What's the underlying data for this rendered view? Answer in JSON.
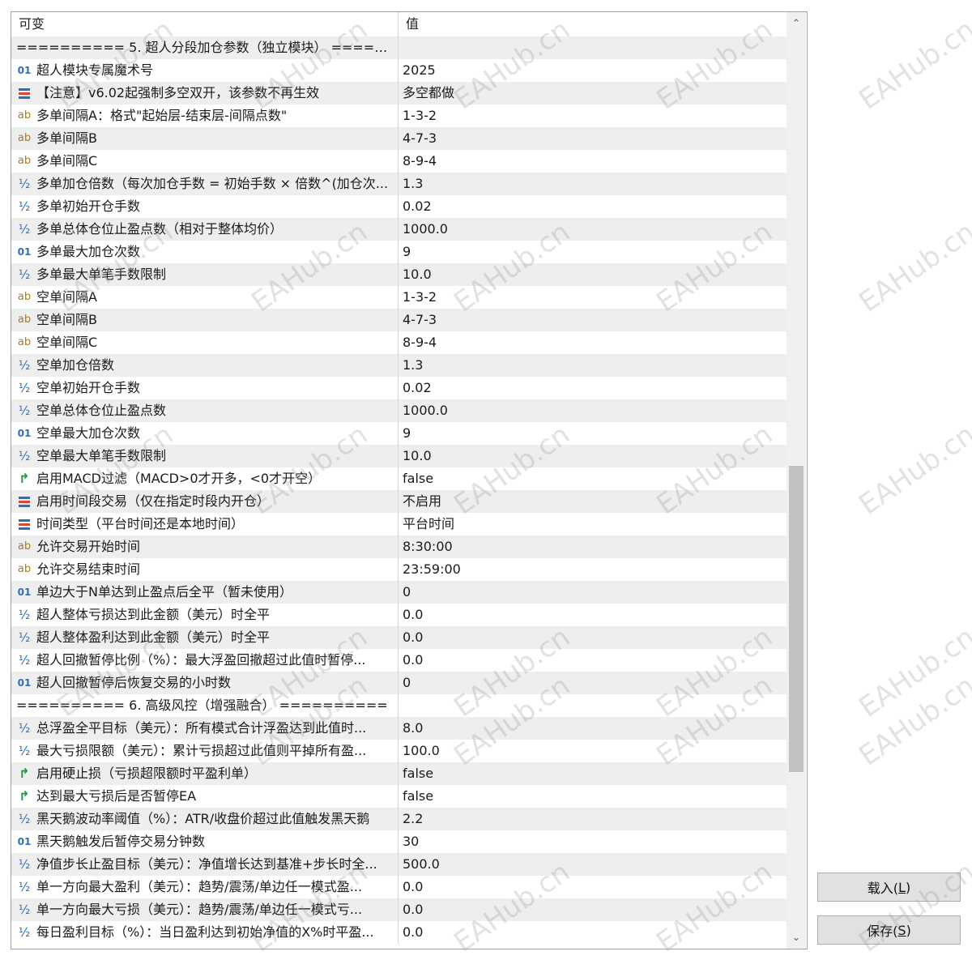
{
  "table": {
    "col_variable": "可变",
    "col_value": "值"
  },
  "rows": [
    {
      "type": "sep",
      "label": "========== 5. 超人分段加仓参数（独立模块） =======...",
      "value": ""
    },
    {
      "type": "int",
      "label": "超人模块专属魔术号",
      "value": "2025"
    },
    {
      "type": "enum",
      "label": "【注意】v6.02起强制多空双开，该参数不再生效",
      "value": "多空都做"
    },
    {
      "type": "str",
      "label": "多单间隔A：格式\"起始层-结束层-间隔点数\"",
      "value": "1-3-2"
    },
    {
      "type": "str",
      "label": "多单间隔B",
      "value": "4-7-3"
    },
    {
      "type": "str",
      "label": "多单间隔C",
      "value": "8-9-4"
    },
    {
      "type": "dbl",
      "label": "多单加仓倍数（每次加仓手数 = 初始手数 × 倍数^(加仓次...",
      "value": "1.3"
    },
    {
      "type": "dbl",
      "label": "多单初始开仓手数",
      "value": "0.02"
    },
    {
      "type": "dbl",
      "label": "多单总体仓位止盈点数（相对于整体均价）",
      "value": "1000.0"
    },
    {
      "type": "int",
      "label": "多单最大加仓次数",
      "value": "9"
    },
    {
      "type": "dbl",
      "label": "多单最大单笔手数限制",
      "value": "10.0"
    },
    {
      "type": "str",
      "label": "空单间隔A",
      "value": "1-3-2"
    },
    {
      "type": "str",
      "label": "空单间隔B",
      "value": "4-7-3"
    },
    {
      "type": "str",
      "label": "空单间隔C",
      "value": "8-9-4"
    },
    {
      "type": "dbl",
      "label": "空单加仓倍数",
      "value": "1.3"
    },
    {
      "type": "dbl",
      "label": "空单初始开仓手数",
      "value": "0.02"
    },
    {
      "type": "dbl",
      "label": "空单总体仓位止盈点数",
      "value": "1000.0"
    },
    {
      "type": "int",
      "label": "空单最大加仓次数",
      "value": "9"
    },
    {
      "type": "dbl",
      "label": "空单最大单笔手数限制",
      "value": "10.0"
    },
    {
      "type": "bool",
      "label": "启用MACD过滤（MACD>0才开多，<0才开空）",
      "value": "false"
    },
    {
      "type": "enum",
      "label": "启用时间段交易（仅在指定时段内开仓）",
      "value": "不启用"
    },
    {
      "type": "enum",
      "label": "时间类型（平台时间还是本地时间）",
      "value": "平台时间"
    },
    {
      "type": "str",
      "label": "允许交易开始时间",
      "value": "8:30:00"
    },
    {
      "type": "str",
      "label": "允许交易结束时间",
      "value": "23:59:00"
    },
    {
      "type": "int",
      "label": "单边大于N单达到止盈点后全平（暂未使用）",
      "value": "0"
    },
    {
      "type": "dbl",
      "label": "超人整体亏损达到此金额（美元）时全平",
      "value": "0.0"
    },
    {
      "type": "dbl",
      "label": "超人整体盈利达到此金额（美元）时全平",
      "value": "0.0"
    },
    {
      "type": "dbl",
      "label": "超人回撤暂停比例（%）：最大浮盈回撤超过此值时暂停...",
      "value": "0.0"
    },
    {
      "type": "int",
      "label": "超人回撤暂停后恢复交易的小时数",
      "value": "0"
    },
    {
      "type": "sep",
      "label": "========== 6. 高级风控（增强融合） ==========",
      "value": ""
    },
    {
      "type": "dbl",
      "label": "总浮盈全平目标（美元）：所有模式合计浮盈达到此值时...",
      "value": "8.0"
    },
    {
      "type": "dbl",
      "label": "最大亏损限额（美元）：累计亏损超过此值则平掉所有盈...",
      "value": "100.0"
    },
    {
      "type": "bool",
      "label": "启用硬止损（亏损超限额时平盈利单）",
      "value": "false"
    },
    {
      "type": "bool",
      "label": "达到最大亏损后是否暂停EA",
      "value": "false"
    },
    {
      "type": "dbl",
      "label": "黑天鹅波动率阈值（%）：ATR/收盘价超过此值触发黑天鹅",
      "value": "2.2"
    },
    {
      "type": "int",
      "label": "黑天鹅触发后暂停交易分钟数",
      "value": "30"
    },
    {
      "type": "dbl",
      "label": "净值步长止盈目标（美元）：净值增长达到基准+步长时全...",
      "value": "500.0"
    },
    {
      "type": "dbl",
      "label": "单一方向最大盈利（美元）：趋势/震荡/单边任一模式盈...",
      "value": "0.0"
    },
    {
      "type": "dbl",
      "label": "单一方向最大亏损（美元）：趋势/震荡/单边任一模式亏...",
      "value": "0.0"
    },
    {
      "type": "dbl",
      "label": "每日盈利目标（%）：当日盈利达到初始净值的X%时平盈...",
      "value": "0.0"
    }
  ],
  "icons": {
    "int": "01",
    "str": "ab",
    "dbl": "½",
    "bool": "↱"
  },
  "icon_names": {
    "int": "integer-type-icon",
    "str": "string-type-icon",
    "dbl": "double-type-icon",
    "bool": "boolean-type-icon",
    "enum": "enum-type-icon"
  },
  "buttons": {
    "load_label": "载入(",
    "load_key": "L",
    "save_label": "保存(",
    "save_key": "S",
    "close_paren": ")"
  },
  "watermark": "EAHub.cn",
  "colors": {
    "int_icon": "#2f6db5",
    "str_icon": "#b07a14",
    "bool_icon": "#1a9a3a",
    "enum_bar_1": "#2f6db5",
    "enum_bar_2": "#d24a3a",
    "enum_bar_3": "#2f6db5"
  }
}
